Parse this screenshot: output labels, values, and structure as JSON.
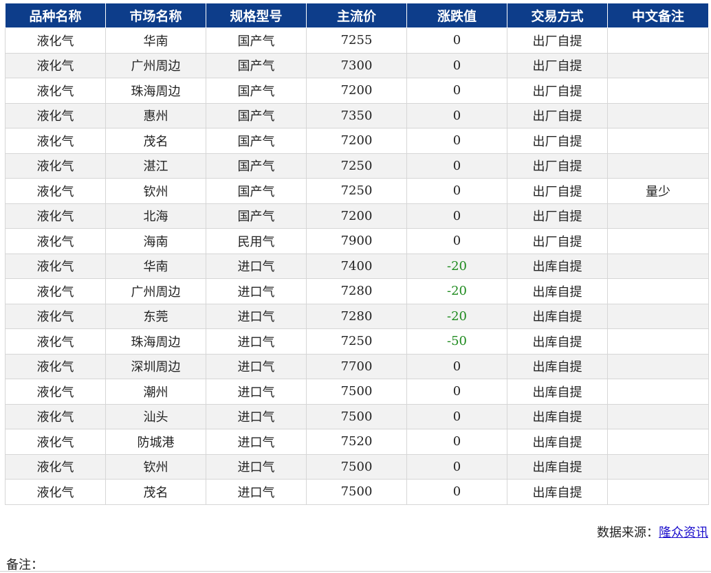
{
  "table": {
    "headers": [
      "品种名称",
      "市场名称",
      "规格型号",
      "主流价",
      "涨跌值",
      "交易方式",
      "中文备注"
    ],
    "rows": [
      [
        "液化气",
        "华南",
        "国产气",
        "7255",
        "0",
        "出厂自提",
        ""
      ],
      [
        "液化气",
        "广州周边",
        "国产气",
        "7300",
        "0",
        "出厂自提",
        ""
      ],
      [
        "液化气",
        "珠海周边",
        "国产气",
        "7200",
        "0",
        "出厂自提",
        ""
      ],
      [
        "液化气",
        "惠州",
        "国产气",
        "7350",
        "0",
        "出厂自提",
        ""
      ],
      [
        "液化气",
        "茂名",
        "国产气",
        "7200",
        "0",
        "出厂自提",
        ""
      ],
      [
        "液化气",
        "湛江",
        "国产气",
        "7250",
        "0",
        "出厂自提",
        ""
      ],
      [
        "液化气",
        "钦州",
        "国产气",
        "7250",
        "0",
        "出厂自提",
        "量少"
      ],
      [
        "液化气",
        "北海",
        "国产气",
        "7200",
        "0",
        "出厂自提",
        ""
      ],
      [
        "液化气",
        "海南",
        "民用气",
        "7900",
        "0",
        "出厂自提",
        ""
      ],
      [
        "液化气",
        "华南",
        "进口气",
        "7400",
        "-20",
        "出库自提",
        ""
      ],
      [
        "液化气",
        "广州周边",
        "进口气",
        "7280",
        "-20",
        "出库自提",
        ""
      ],
      [
        "液化气",
        "东莞",
        "进口气",
        "7280",
        "-20",
        "出库自提",
        ""
      ],
      [
        "液化气",
        "珠海周边",
        "进口气",
        "7250",
        "-50",
        "出库自提",
        ""
      ],
      [
        "液化气",
        "深圳周边",
        "进口气",
        "7700",
        "0",
        "出库自提",
        ""
      ],
      [
        "液化气",
        "潮州",
        "进口气",
        "7500",
        "0",
        "出库自提",
        ""
      ],
      [
        "液化气",
        "汕头",
        "进口气",
        "7500",
        "0",
        "出库自提",
        ""
      ],
      [
        "液化气",
        "防城港",
        "进口气",
        "7520",
        "0",
        "出库自提",
        ""
      ],
      [
        "液化气",
        "钦州",
        "进口气",
        "7500",
        "0",
        "出库自提",
        ""
      ],
      [
        "液化气",
        "茂名",
        "进口气",
        "7500",
        "0",
        "出库自提",
        ""
      ]
    ]
  },
  "footer": {
    "source_label": "数据来源：",
    "source_link": "隆众资讯",
    "note_label": "备注："
  },
  "colors": {
    "header_bg": "#0d3d8a",
    "negative_change": "#1e8a1e",
    "link": "#1a0dcc"
  }
}
